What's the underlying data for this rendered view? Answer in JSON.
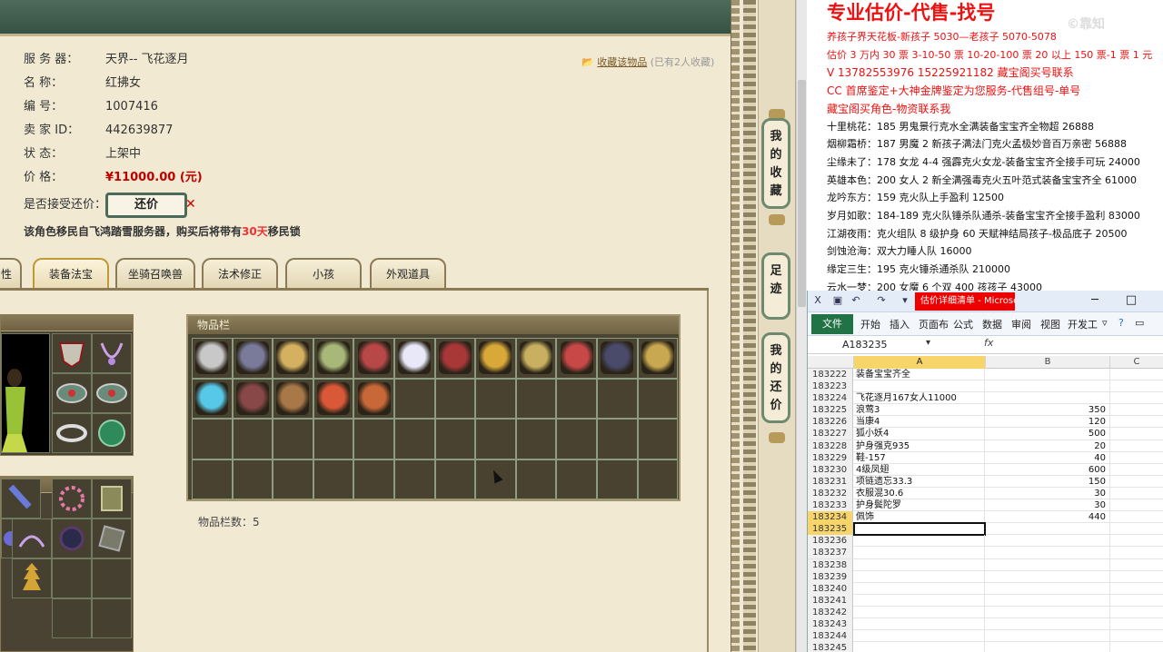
{
  "game": {
    "server_label": "服 务 器：",
    "server_value": "天界-- 飞花逐月",
    "name_label": "名          称：",
    "name_value": "红拂女",
    "number_label": "编          号：",
    "number_value": "1007416",
    "seller_label": "卖 家  ID：",
    "seller_value": "442639877",
    "status_label": "状          态：",
    "status_value": "上架中",
    "price_label": "价          格：",
    "price_value": "¥11000.00 (元)",
    "haggle_label": "是否接受还价：",
    "haggle_button": "还价",
    "favorite_link": "收藏该物品",
    "favorite_count": "(已有2人收藏)",
    "migrate_prefix": "该角色移民自飞鸿踏雪服务器，购买后将带有",
    "migrate_days": "30天",
    "migrate_suffix": "移民锁",
    "tabs": [
      "性",
      "装备法宝",
      "坐骑召唤兽",
      "法术修正",
      "小孩",
      "外观道具"
    ],
    "items_title": "物品栏",
    "items_count": "物品栏数：5",
    "side_buttons": [
      "我的收藏",
      "足迹",
      "我的还价"
    ]
  },
  "notes": {
    "title": "专业估价-代售-找号",
    "watermark": "©靠知",
    "lines": [
      {
        "text": "养孩子界天花板-新孩子 5030—老孩子 5070-5078",
        "style": "red"
      },
      {
        "text": "估价 3 万内 30 票  3-10-50 票  10-20-100 票 20 以上 150 票-1 票 1 元",
        "style": "red"
      },
      {
        "text": "V 13782553976    15225921182   藏宝阁买号联系",
        "style": "red-big"
      },
      {
        "text": "CC 首席鉴定+大神金牌鉴定为您服务-代售组号-单号",
        "style": "red-big"
      },
      {
        "text": "藏宝阁买角色-物资联系我",
        "style": "red-big"
      },
      {
        "text": "十里桃花：185 男鬼景行克水全满装备宝宝齐全物超 26888",
        "style": "black"
      },
      {
        "text": "烟柳霜桥：187 男魔 2 新孩子满法门克火孟极妙音百万亲密 56888",
        "style": "black"
      },
      {
        "text": "尘缘未了：178 女龙 4-4 强霹克火女龙-装备宝宝齐全接手可玩 24000",
        "style": "black"
      },
      {
        "text": "英雄本色：200 女人 2 新全满强毒克火五叶范式装备宝宝齐全 61000",
        "style": "black"
      },
      {
        "text": "龙吟东方：159 克火队上手盈利 12500",
        "style": "black"
      },
      {
        "text": "岁月如歌：184-189 克火队锤杀队通杀-装备宝宝齐全接手盈利 83000",
        "style": "black"
      },
      {
        "text": "江湖夜雨：克火组队 8 级护身 60 天赋神结局孩子-极品底子 20500",
        "style": "black"
      },
      {
        "text": "剑蚀沧海：双大力睡人队 16000",
        "style": "black"
      },
      {
        "text": "缘定三生：195 克火锤杀通杀队 210000",
        "style": "black"
      },
      {
        "text": "云水一梦：200 女魔 6 个双 400 孩孩子 43000",
        "style": "black"
      }
    ]
  },
  "excel": {
    "window_title": "估价详细清单 - Microsoft Ex...",
    "file_tab": "文件",
    "ribbon_tabs": [
      "开始",
      "插入",
      "页面布",
      "公式",
      "数据",
      "审阅",
      "视图",
      "开发工"
    ],
    "name_box": "A183235",
    "fx": "fx",
    "col_a": "A",
    "col_b": "B",
    "col_c": "C",
    "rows": [
      {
        "n": "183222",
        "a": "装备宝宝齐全",
        "b": ""
      },
      {
        "n": "183223",
        "a": "",
        "b": ""
      },
      {
        "n": "183224",
        "a": "飞花逐月167女人11000",
        "b": ""
      },
      {
        "n": "183225",
        "a": "浪莺3",
        "b": "350"
      },
      {
        "n": "183226",
        "a": "当康4",
        "b": "120"
      },
      {
        "n": "183227",
        "a": "狐小妖4",
        "b": "500"
      },
      {
        "n": "183228",
        "a": "护身强克935",
        "b": "20"
      },
      {
        "n": "183229",
        "a": "鞋-157",
        "b": "40"
      },
      {
        "n": "183230",
        "a": "4级凤翅",
        "b": "600"
      },
      {
        "n": "183231",
        "a": "项链遗忘33.3",
        "b": "150"
      },
      {
        "n": "183232",
        "a": "衣服混30.6",
        "b": "30"
      },
      {
        "n": "183233",
        "a": "护身鬓陀罗",
        "b": "30"
      },
      {
        "n": "183234",
        "a": "佩饰",
        "b": "440"
      },
      {
        "n": "183235",
        "a": "",
        "b": ""
      },
      {
        "n": "183236",
        "a": "",
        "b": ""
      },
      {
        "n": "183237",
        "a": "",
        "b": ""
      },
      {
        "n": "183238",
        "a": "",
        "b": ""
      },
      {
        "n": "183239",
        "a": "",
        "b": ""
      },
      {
        "n": "183240",
        "a": "",
        "b": ""
      },
      {
        "n": "183241",
        "a": "",
        "b": ""
      },
      {
        "n": "183242",
        "a": "",
        "b": ""
      },
      {
        "n": "183243",
        "a": "",
        "b": ""
      },
      {
        "n": "183244",
        "a": "",
        "b": ""
      },
      {
        "n": "183245",
        "a": "",
        "b": ""
      }
    ]
  },
  "colors": {
    "accent_red": "#e11111",
    "frame_green": "#4b6b58",
    "excel_green": "#217346"
  },
  "item_icons": [
    "axe-icon",
    "armor-figure-icon",
    "mask-icon",
    "belt-icon",
    "necklace-icon",
    "pearl-icon",
    "figure-icon",
    "ring-icon",
    "cape-icon",
    "amulet-icon",
    "bracelet-icon",
    "cape-icon",
    "rosary-icon",
    "wings-icon",
    "boots-icon",
    "orb-icon",
    "robe-icon"
  ]
}
